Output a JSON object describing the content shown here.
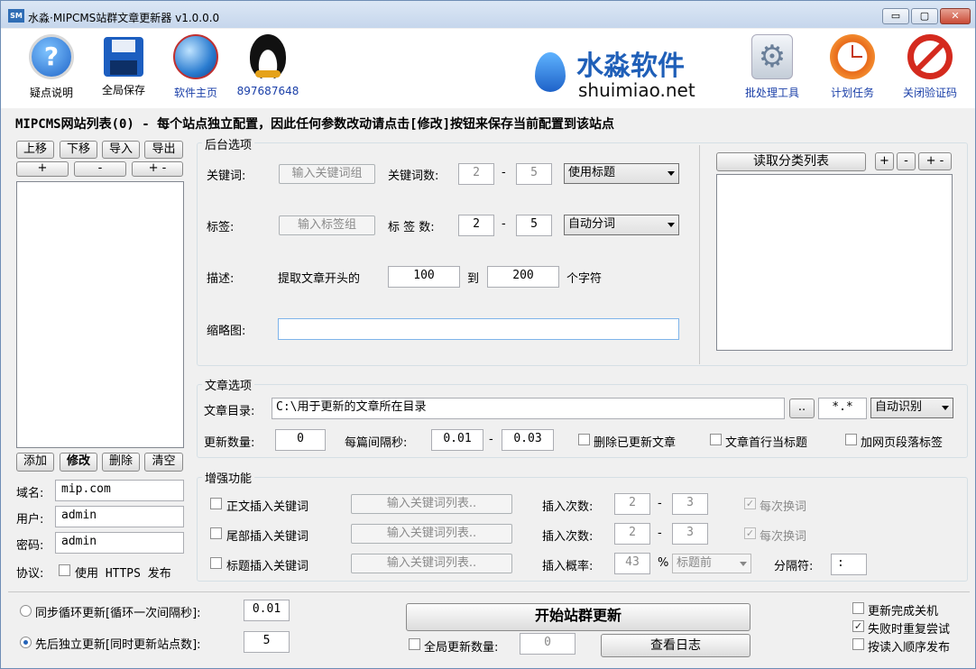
{
  "app": {
    "title": "水淼·MIPCMS站群文章更新器 v1.0.0.0",
    "icon_text": "SM"
  },
  "window_controls": {
    "minimize": "▭",
    "maximize": "▢",
    "close": "✕"
  },
  "toolbar": {
    "left": [
      {
        "label": "疑点说明",
        "icon": "help-icon"
      },
      {
        "label": "全局保存",
        "icon": "floppy-disk-icon"
      },
      {
        "label": "软件主页",
        "icon": "globe-icon"
      },
      {
        "label": "897687648",
        "icon": "qq-penguin-icon"
      }
    ],
    "brand": {
      "name": "水淼软件",
      "url_text": "shuimiao.net"
    },
    "right": [
      {
        "label": "批处理工具",
        "icon": "gear-icon"
      },
      {
        "label": "计划任务",
        "icon": "clock-icon"
      },
      {
        "label": "关闭验证码",
        "icon": "prohibit-icon"
      }
    ]
  },
  "site_list": {
    "header": "MIPCMS网站列表(0) - 每个站点独立配置，因此任何参数改动请点击[修改]按钮来保存当前配置到该站点",
    "buttons": {
      "up": "上移",
      "down": "下移",
      "import": "导入",
      "export": "导出",
      "plus": "+",
      "minus": "-",
      "plusminus": "+ -",
      "add": "添加",
      "modify": "修改",
      "delete": "删除",
      "clear": "清空"
    },
    "domain_label": "域名:",
    "domain": "mip.com",
    "user_label": "用户:",
    "user": "admin",
    "password_label": "密码:",
    "password": "admin",
    "protocol_label": "协议:",
    "https_label": "使用 HTTPS 发布"
  },
  "backend": {
    "title": "后台选项",
    "keyword_label": "关键词:",
    "keyword_button": "输入关键词组",
    "keyword_count_label": "关键词数:",
    "keyword_min": "2",
    "keyword_max": "5",
    "keyword_mode": "使用标题",
    "tag_label": "标签:",
    "tag_button": "输入标签组",
    "tag_count_label": "标 签 数:",
    "tag_min": "2",
    "tag_max": "5",
    "tag_mode": "自动分词",
    "dash": "-",
    "desc_label": "描述:",
    "desc_prefix": "提取文章开头的",
    "desc_from": "100",
    "desc_to_label": "到",
    "desc_to": "200",
    "desc_suffix": "个字符",
    "thumb_label": "缩略图:",
    "thumb_value": ""
  },
  "category": {
    "read_button": "读取分类列表",
    "plus": "+",
    "minus": "-",
    "plusminus": "+ -"
  },
  "article": {
    "title": "文章选项",
    "dir_label": "文章目录:",
    "dir_value": "C:\\用于更新的文章所在目录",
    "browse": "..",
    "pattern": "*.*",
    "encoding": "自动识别",
    "count_label": "更新数量:",
    "count": "0",
    "interval_label": "每篇间隔秒:",
    "interval_min": "0.01",
    "interval_max": "0.03",
    "delete_label": "删除已更新文章",
    "firstline_label": "文章首行当标题",
    "para_tag_label": "加网页段落标签"
  },
  "enhance": {
    "title": "增强功能",
    "rows": [
      {
        "check": "正文插入关键词",
        "button": "输入关键词列表..",
        "times_label": "插入次数:",
        "min": "2",
        "max": "3",
        "change": "每次换词"
      },
      {
        "check": "尾部插入关键词",
        "button": "输入关键词列表..",
        "times_label": "插入次数:",
        "min": "2",
        "max": "3",
        "change": "每次换词"
      }
    ],
    "title_row": {
      "check": "标题插入关键词",
      "button": "输入关键词列表..",
      "prob_label": "插入概率:",
      "prob": "43",
      "percent": "%",
      "position": "标题前",
      "sep_label": "分隔符:",
      "sep": ":"
    }
  },
  "bottom": {
    "sync_label": "同步循环更新[循环一次间隔秒]:",
    "sync_value": "0.01",
    "seq_label": "先后独立更新[同时更新站点数]:",
    "seq_value": "5",
    "start_button": "开始站群更新",
    "global_count_label": "全局更新数量:",
    "global_count": "0",
    "log_button": "查看日志",
    "shutdown_label": "更新完成关机",
    "retry_label": "失败时重复尝试",
    "order_label": "按读入顺序发布"
  }
}
